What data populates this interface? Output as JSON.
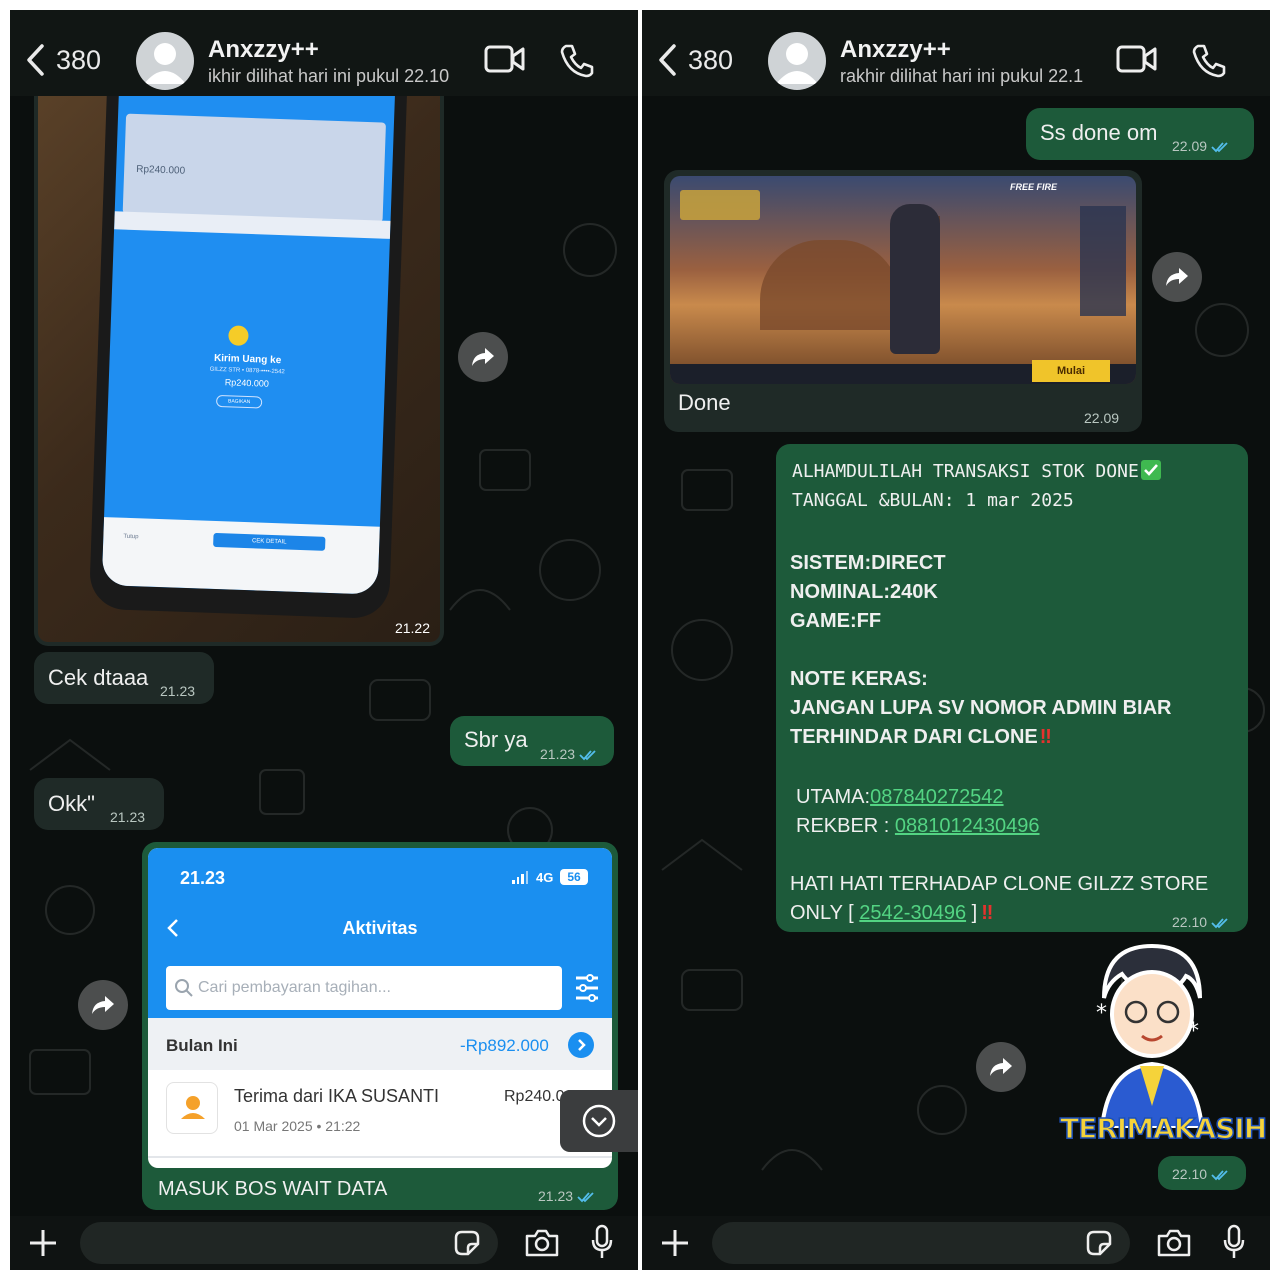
{
  "left": {
    "header": {
      "back_count": "380",
      "contact_name": "Anxzzy++",
      "last_seen": "ikhir dilihat hari ini pukul 22.10"
    },
    "messages": {
      "photo_time": "21.22",
      "photo_phone": {
        "amount_top": "Rp240.000",
        "kirim_label": "Kirim Uang ke",
        "kirim_detail": "GILZZ STR • 0878-••••-2542",
        "kirim_amount": "Rp240.000",
        "bagikan": "BAGIKAN",
        "cek_detail": "CEK DETAIL",
        "tutup": "Tutup"
      },
      "cek_dtaaa": "Cek dtaaa",
      "cek_dtaaa_time": "21.23",
      "sbr_ya": "Sbr ya",
      "sbr_ya_time": "21.23",
      "okk": "Okk\"",
      "okk_time": "21.23",
      "screenshot": {
        "status_time": "21.23",
        "network": "4G",
        "battery": "56",
        "title": "Aktivitas",
        "search_placeholder": "Cari pembayaran tagihan...",
        "month_label": "Bulan Ini",
        "month_total": "-Rp892.000",
        "tx_title": "Terima dari IKA SUSANTI",
        "tx_amount": "Rp240.000",
        "tx_date": "01 Mar 2025 • 21:22"
      },
      "caption": "MASUK BOS WAIT DATA",
      "caption_time": "21.23"
    }
  },
  "right": {
    "header": {
      "back_count": "380",
      "contact_name": "Anxzzy++",
      "last_seen": "rakhir dilihat hari ini pukul 22.1"
    },
    "messages": {
      "ss_done": "Ss done om",
      "ss_done_time": "22.09",
      "game_brand": "FREE FIRE",
      "game_start": "Mulai",
      "done": "Done",
      "done_time": "22.09",
      "receipt": {
        "line1": "ALHAMDULILAH TRANSAKSI STOK DONE",
        "line2": "TANGGAL &BULAN: 1 mar 2025",
        "sistem": "SISTEM:DIRECT",
        "nominal": "NOMINAL:240K",
        "game": "GAME:FF",
        "note_title": "NOTE KERAS:",
        "note_body1": "JANGAN LUPA SV NOMOR ADMIN BIAR",
        "note_body2": "TERHINDAR DARI CLONE",
        "utama_label": "UTAMA:",
        "utama_number": "087840272542",
        "rekber_label": "REKBER : ",
        "rekber_number": "0881012430496",
        "warning1": "HATI HATI TERHADAP CLONE GILZZ STORE",
        "warning2_pre": "ONLY [ ",
        "warning2_code": "2542-30496",
        "warning2_post": " ]",
        "time": "22.10"
      },
      "sticker_text": "TERIMAKASIH",
      "sticker_time": "22.10"
    }
  },
  "icons": [
    "back-chevron-icon",
    "avatar",
    "video-call-icon",
    "phone-icon",
    "forward-icon",
    "plus-icon",
    "sticker-icon",
    "camera-icon",
    "mic-icon",
    "double-check-icon",
    "scroll-down-icon",
    "search-icon",
    "filter-icon"
  ],
  "colors": {
    "outgoing": "#1d5a3a",
    "incoming": "#1f2a27",
    "link": "#53d483",
    "tick": "#53bdeb"
  }
}
